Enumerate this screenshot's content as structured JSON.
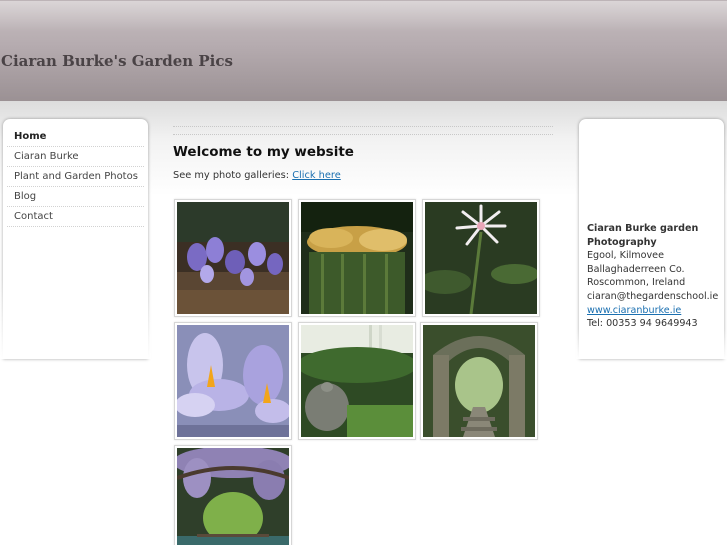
{
  "header": {
    "site_title": "Ciaran Burke's Garden Pics"
  },
  "nav": {
    "items": [
      {
        "label": "Home"
      },
      {
        "label": "Ciaran Burke"
      },
      {
        "label": "Plant and Garden Photos"
      },
      {
        "label": "Blog"
      },
      {
        "label": "Contact"
      }
    ]
  },
  "main": {
    "heading": "Welcome to my website",
    "galleries_text": "See my photo galleries: ",
    "galleries_link": "Click here",
    "photos": [
      "crocus-woodland-photo",
      "golden-grass-photo",
      "white-flower-photo",
      "crocus-closeup-photo",
      "stone-lantern-garden-photo",
      "rose-arch-path-photo",
      "wisteria-pond-photo"
    ]
  },
  "contact": {
    "name": "Ciaran Burke garden Photography",
    "address_1": "Egool, Kilmovee",
    "address_2": "Ballaghaderreen Co.",
    "address_3": "Roscommon, Ireland",
    "email": "ciaran@thegardenschool.ie",
    "website": "www.ciaranburke.ie",
    "phone": "Tel: 00353 94 9649943"
  }
}
